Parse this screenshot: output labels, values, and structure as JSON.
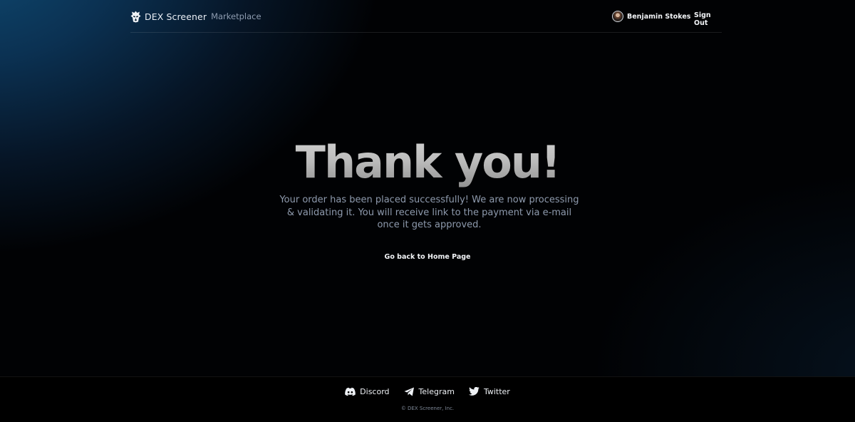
{
  "header": {
    "brand_name": "DEX Screener",
    "brand_sub": "Marketplace",
    "user_name": "Benjamin Stokes",
    "sign_out_label": "Sign Out"
  },
  "hero": {
    "title": "Thank you!",
    "message": "Your order has been placed successfully! We are now processing & validating it. You will receive link to the payment via e-mail once it gets approved.",
    "home_link_label": "Go back to Home Page"
  },
  "footer": {
    "socials": [
      {
        "label": "Discord",
        "icon": "discord-icon"
      },
      {
        "label": "Telegram",
        "icon": "telegram-icon"
      },
      {
        "label": "Twitter",
        "icon": "twitter-icon"
      }
    ],
    "copyright": "© DEX Screener, Inc."
  },
  "colors": {
    "background": "#010204",
    "accent_glow": "#0f4a72",
    "text_primary": "#f2f4f7",
    "text_muted": "#8e9aad"
  }
}
